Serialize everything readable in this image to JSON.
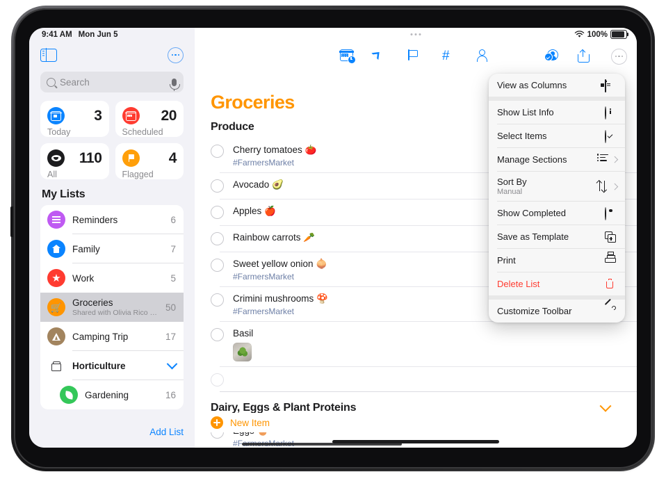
{
  "status_bar": {
    "time": "9:41 AM",
    "date": "Mon Jun 5",
    "battery": "100%"
  },
  "sidebar": {
    "search": {
      "placeholder": "Search"
    },
    "smart_cards": [
      {
        "label": "Today",
        "count": "3",
        "icon": "today-icon"
      },
      {
        "label": "Scheduled",
        "count": "20",
        "icon": "scheduled-icon"
      },
      {
        "label": "All",
        "count": "110",
        "icon": "all-icon"
      },
      {
        "label": "Flagged",
        "count": "4",
        "icon": "flagged-icon"
      }
    ],
    "section_title": "My Lists",
    "lists": [
      {
        "name": "Reminders",
        "count": "6",
        "subtitle": ""
      },
      {
        "name": "Family",
        "count": "7",
        "subtitle": ""
      },
      {
        "name": "Work",
        "count": "5",
        "subtitle": ""
      },
      {
        "name": "Groceries",
        "count": "50",
        "subtitle": "Shared with Olivia Rico & 3..."
      },
      {
        "name": "Camping Trip",
        "count": "17",
        "subtitle": ""
      },
      {
        "name": "Horticulture",
        "count": "",
        "subtitle": ""
      },
      {
        "name": "Gardening",
        "count": "16",
        "subtitle": ""
      }
    ],
    "add_list_label": "Add List"
  },
  "main": {
    "title": "Groceries",
    "new_item_label": "New Item",
    "sections": [
      {
        "name": "Produce",
        "items": [
          {
            "title": "Cherry tomatoes 🍅",
            "tag": "#FarmersMarket"
          },
          {
            "title": "Avocado 🥑",
            "tag": ""
          },
          {
            "title": "Apples 🍎",
            "tag": ""
          },
          {
            "title": "Rainbow carrots 🥕",
            "tag": ""
          },
          {
            "title": "Sweet yellow onion 🧅",
            "tag": "#FarmersMarket"
          },
          {
            "title": "Crimini mushrooms 🍄",
            "tag": ""
          },
          {
            "title": "Basil",
            "tag": ""
          },
          {
            "title": "",
            "tag": ""
          }
        ]
      },
      {
        "name": "Dairy, Eggs & Plant Proteins",
        "items": [
          {
            "title": "Eggs 🥚",
            "tag": "#FarmersMarket"
          }
        ]
      }
    ]
  },
  "toolbar": {
    "icons": [
      "add-date-icon",
      "location-icon",
      "flag-icon",
      "tag-icon",
      "person-icon"
    ],
    "right_icons": [
      "share-participants-icon",
      "share-icon",
      "more-icon"
    ]
  },
  "menu": {
    "items": [
      {
        "label": "View as Columns",
        "sub": "",
        "icon": "columns-icon",
        "danger": false,
        "chevron": false
      },
      {
        "label": "Show List Info",
        "sub": "",
        "icon": "info-icon",
        "danger": false,
        "chevron": false
      },
      {
        "label": "Select Items",
        "sub": "",
        "icon": "checkmark-circle-icon",
        "danger": false,
        "chevron": false
      },
      {
        "label": "Manage Sections",
        "sub": "",
        "icon": "sections-icon",
        "danger": false,
        "chevron": true
      },
      {
        "label": "Sort By",
        "sub": "Manual",
        "icon": "sort-icon",
        "danger": false,
        "chevron": true
      },
      {
        "label": "Show Completed",
        "sub": "",
        "icon": "eye-icon",
        "danger": false,
        "chevron": false
      },
      {
        "label": "Save as Template",
        "sub": "",
        "icon": "template-icon",
        "danger": false,
        "chevron": false
      },
      {
        "label": "Print",
        "sub": "",
        "icon": "printer-icon",
        "danger": false,
        "chevron": false
      },
      {
        "label": "Delete List",
        "sub": "",
        "icon": "trash-icon",
        "danger": true,
        "chevron": false
      },
      {
        "label": "Customize Toolbar",
        "sub": "",
        "icon": "wrench-icon",
        "danger": false,
        "chevron": false
      }
    ]
  },
  "colors": {
    "accent_orange": "#ff9500",
    "accent_blue": "#0a84ff",
    "danger_red": "#ff3b30"
  }
}
